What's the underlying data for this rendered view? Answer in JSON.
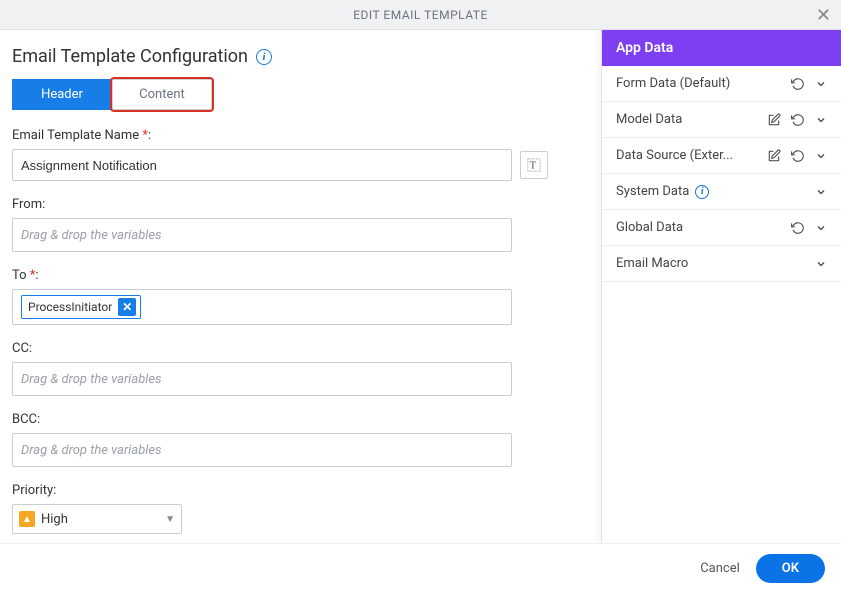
{
  "dialog": {
    "title": "EDIT EMAIL TEMPLATE"
  },
  "section": {
    "title": "Email Template Configuration"
  },
  "tabs": {
    "header": "Header",
    "content": "Content"
  },
  "fields": {
    "name_label": "Email Template Name",
    "name_value": "Assignment Notification",
    "from_label": "From:",
    "from_placeholder": "Drag & drop the variables",
    "to_label": "To",
    "to_chip": "ProcessInitiator",
    "cc_label": "CC:",
    "cc_placeholder": "Drag & drop the variables",
    "bcc_label": "BCC:",
    "bcc_placeholder": "Drag & drop the variables",
    "priority_label": "Priority:",
    "priority_value": "High"
  },
  "appdata": {
    "header": "App Data",
    "items": {
      "form": "Form Data (Default)",
      "model": "Model Data",
      "datasource": "Data Source (Exter...",
      "system": "System Data",
      "global": "Global Data",
      "macro": "Email Macro"
    }
  },
  "footer": {
    "cancel": "Cancel",
    "ok": "OK"
  }
}
